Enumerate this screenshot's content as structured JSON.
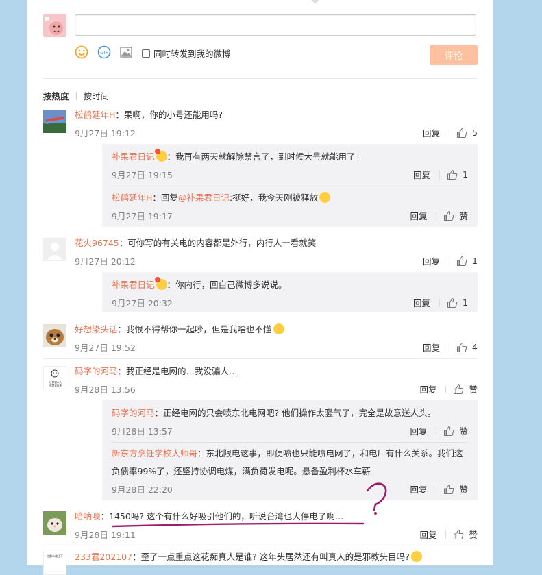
{
  "composer": {
    "placeholder": "",
    "forward_label": "同时转发到我的微博",
    "submit_label": "评论"
  },
  "sort": {
    "hot": "按热度",
    "time": "按时间"
  },
  "actions": {
    "reply": "回复",
    "like": "赞"
  },
  "comments": [
    {
      "user": "松鹤延年H",
      "text": "：果啊，你的小号还能用吗?",
      "time": "9月27日 19:12",
      "likes": "5",
      "replies": [
        {
          "user": "补果君日记",
          "text": "：我再有两天就解除禁言了，到时候大号就能用了。",
          "time": "9月27日 19:15",
          "likes": "1"
        },
        {
          "user": "松鹤延年H",
          "text_pre": "：回复",
          "mention": "@补果君日记",
          "text": ":挺好，我今天刚被释放",
          "time": "9月27日 19:17",
          "likes": "赞"
        }
      ]
    },
    {
      "user": "花火96745",
      "text": "：可你写的有关电的内容都是外行，内行人一看就笑",
      "time": "9月27日 20:12",
      "likes": "1",
      "replies": [
        {
          "user": "补果君日记",
          "text": "：你内行，回自己微博多说说。",
          "time": "9月27日 20:32",
          "likes": "1"
        }
      ]
    },
    {
      "user": "好想染头话",
      "text": "：我恨不得帮你一起吵，但是我啥也不懂",
      "time": "9月27日 19:52",
      "likes": "4"
    },
    {
      "user": "码字的河马",
      "text": "：我正经是电网的…我没骗人…",
      "time": "9月28日 13:56",
      "likes": "赞",
      "avatar_text_1": "世界很么大",
      "avatar_text_2": "我想说出来",
      "replies": [
        {
          "user": "码字的河马",
          "text": "：正经电网的只会喷东北电网吧? 他们操作太骚气了，完全是故意送人头。",
          "time": "9月28日 13:57",
          "likes": "赞"
        },
        {
          "user": "新东方烹饪学校大师哥",
          "text": "：东北限电这事，即便喷也只能喷电网了，和电厂有什么关系。我们这",
          "text2": "负债率99%了，还坚持协调电煤，满负荷发电呢。悬备盈利杯水车薪",
          "time": "9月28日 22:20",
          "likes": "赞"
        }
      ]
    },
    {
      "user": "哈呐噢",
      "text": "：1450吗? 这个有什么好吸引他们的，听说台湾也大停电了啊…",
      "time": "9月28日 19:11",
      "likes": "赞"
    },
    {
      "user": "233君202107",
      "text": "：歪了一点重点这花痴真人是谁? 这年头居然还有叫真人的是邪教头目吗?",
      "avatar_text": "也晨么我还不"
    }
  ],
  "colors": {
    "username": "#eb7350",
    "submit": "#ffc09f",
    "annotation": "#9c1f6e"
  }
}
